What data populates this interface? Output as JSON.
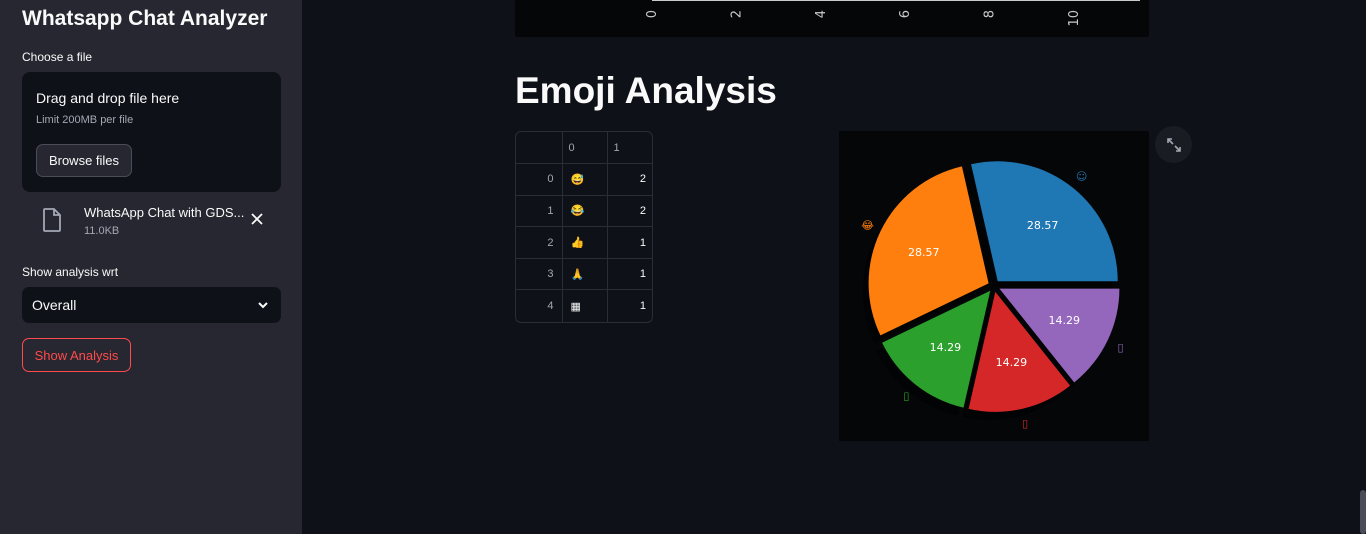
{
  "sidebar": {
    "title": "Whatsapp Chat Analyzer",
    "choose_label": "Choose a file",
    "dropzone_title": "Drag and drop file here",
    "dropzone_limit": "Limit 200MB per file",
    "browse_label": "Browse files",
    "file_name": "WhatsApp Chat with GDS...",
    "file_size": "11.0KB",
    "analysis_label": "Show analysis wrt",
    "select_value": "Overall",
    "show_button": "Show Analysis"
  },
  "top_chart": {
    "x_ticks": [
      "0",
      "2",
      "4",
      "6",
      "8",
      "10"
    ]
  },
  "main": {
    "heading": "Emoji Analysis"
  },
  "emoji_table": {
    "headers": [
      "",
      "0",
      "1"
    ],
    "rows": [
      {
        "index": "0",
        "emoji": "😅",
        "count": "2"
      },
      {
        "index": "1",
        "emoji": "😂",
        "count": "2"
      },
      {
        "index": "2",
        "emoji": "👍",
        "count": "1"
      },
      {
        "index": "3",
        "emoji": "🙏",
        "count": "1"
      },
      {
        "index": "4",
        "emoji": "▦",
        "count": "1"
      }
    ]
  },
  "chart_data": {
    "type": "pie",
    "categories": [
      "😅",
      "😂",
      "👍",
      "🙏",
      "▦"
    ],
    "values": [
      28.57,
      28.57,
      14.29,
      14.29,
      14.29
    ],
    "labels": [
      "28.57",
      "28.57",
      "14.29",
      "14.29",
      "14.29"
    ],
    "outer_labels": [
      "☺",
      "😂",
      "▯",
      "▯",
      "▯"
    ],
    "colors": [
      "#1f77b4",
      "#ff7f0e",
      "#2ca02c",
      "#d62728",
      "#9467bd"
    ]
  }
}
